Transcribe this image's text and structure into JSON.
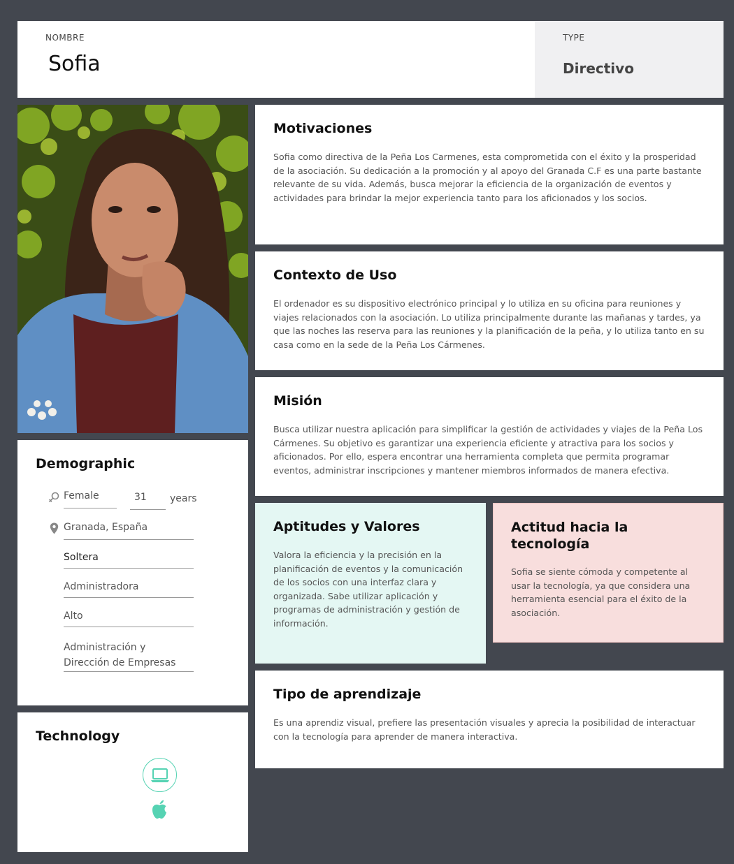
{
  "header": {
    "name_caption": "NOMBRE",
    "name": "Sofia",
    "type_caption": "TYPE",
    "type": "Directivo"
  },
  "motivaciones": {
    "title": "Motivaciones",
    "text": "Sofia como directiva de la Peña Los Carmenes, esta comprometida con el éxito y la prosperidad de la asociación. Su dedicación a la promoción y al apoyo del Granada C.F es una parte bastante relevante de su vida. Además, busca mejorar la eficiencia de la organización de eventos y actividades para brindar la mejor experiencia tanto para los aficionados y los socios."
  },
  "contexto": {
    "title": "Contexto de Uso",
    "text": "El ordenador es su dispositivo electrónico principal y lo utiliza en su oficina para reuniones y viajes relacionados con la asociación. Lo utiliza principalmente durante las mañanas y tardes, ya que las noches las reserva para las reuniones y la planificación de la peña, y lo utiliza tanto en su casa como en la sede de la Peña Los Cármenes."
  },
  "mision": {
    "title": "Misión",
    "text": "Busca utilizar nuestra aplicación para simplificar la gestión de actividades y viajes de la Peña Los Cármenes. Su objetivo es garantizar una experiencia eficiente y atractiva para los socios y aficionados. Por ello, espera encontrar una herramienta completa que permita programar eventos, administrar inscripciones y mantener miembros informados de manera efectiva."
  },
  "aptitudes": {
    "title": "Aptitudes y Valores",
    "text": "Valora la eficiencia y la precisión en la planificación de eventos y la comunicación de los socios con una interfaz clara y organizada. Sabe utilizar aplicación y programas de administración y gestión de información."
  },
  "actitud": {
    "title": "Actitud hacia la tecnología",
    "text": "Sofia se siente cómoda y competente al usar la tecnología, ya que considera una herramienta esencial para el éxito de la asociación."
  },
  "aprendizaje": {
    "title": "Tipo de aprendizaje",
    "text": "Es una aprendiz visual, prefiere las presentación visuales y aprecia la posibilidad de interactuar con la tecnología para aprender de manera interactiva."
  },
  "demographic": {
    "title": "Demographic",
    "gender": "Female",
    "age": "31",
    "age_unit": "years",
    "location": "Granada, España",
    "status": "Soltera",
    "occupation": "Administradora",
    "level": "Alto",
    "education": "Administración y Dirección de Empresas",
    "icons": [
      "gender-icon",
      "location-pin-icon"
    ]
  },
  "technology": {
    "title": "Technology",
    "icons": [
      "laptop-icon",
      "apple-icon"
    ],
    "accent": "#56d3b3"
  },
  "colors": {
    "background": "#43474f",
    "aptitudes_bg": "#e4f7f3",
    "actitud_bg": "#f8dedd",
    "type_bg": "#f0f0f2"
  }
}
